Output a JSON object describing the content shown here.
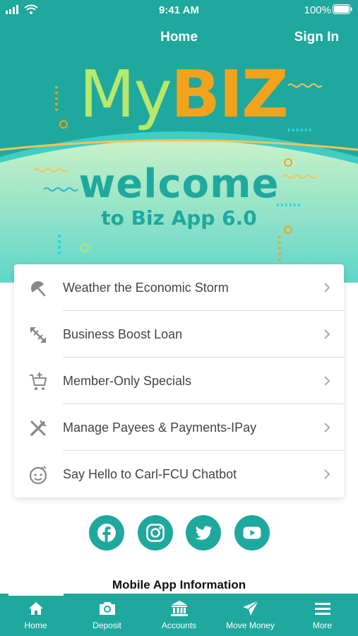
{
  "status_bar": {
    "time": "9:41 AM",
    "battery": "100%"
  },
  "header": {
    "title": "Home",
    "sign_in_label": "Sign In"
  },
  "hero": {
    "logo_my": "My",
    "logo_biz": "BIZ",
    "welcome": "welcome",
    "welcome_sub": "to Biz App 6.0"
  },
  "menu": {
    "items": [
      {
        "label": "Weather the Economic Storm",
        "icon": "umbrella-icon"
      },
      {
        "label": "Business Boost Loan",
        "icon": "arrows-expand-icon"
      },
      {
        "label": "Member-Only Specials",
        "icon": "cart-plus-icon"
      },
      {
        "label": "Manage Payees & Payments-IPay",
        "icon": "tools-icon"
      },
      {
        "label": "Say Hello to Carl-FCU Chatbot",
        "icon": "smiley-icon"
      }
    ]
  },
  "social": [
    "facebook-icon",
    "instagram-icon",
    "twitter-icon",
    "youtube-icon"
  ],
  "footer": {
    "app_info": "Mobile App Information"
  },
  "tabs": [
    {
      "label": "Home",
      "icon": "home-icon"
    },
    {
      "label": "Deposit",
      "icon": "camera-icon"
    },
    {
      "label": "Accounts",
      "icon": "bank-icon"
    },
    {
      "label": "Move Money",
      "icon": "send-icon"
    },
    {
      "label": "More",
      "icon": "menu-icon"
    }
  ],
  "colors": {
    "brand": "#1fa89e",
    "accent": "#f3a31b",
    "lime": "#b7e86a"
  }
}
